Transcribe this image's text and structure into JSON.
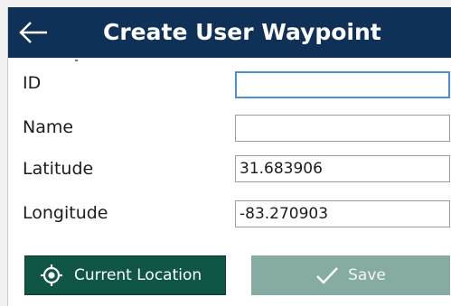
{
  "header": {
    "title": "Create User Waypoint"
  },
  "form": {
    "id": {
      "label": "ID",
      "value": ""
    },
    "name": {
      "label": "Name",
      "value": ""
    },
    "latitude": {
      "label": "Latitude",
      "value": "31.683906"
    },
    "longitude": {
      "label": "Longitude",
      "value": "-83.270903"
    }
  },
  "actions": {
    "current_location_label": "Current Location",
    "save_label": "Save"
  },
  "icons": {
    "back": "back-arrow-icon",
    "location": "crosshair-location-icon",
    "save": "checkmark-icon"
  },
  "colors": {
    "titlebar": "#0f3158",
    "location_button": "#0f5647",
    "save_button_disabled": "#86aba2",
    "focus_border": "#4c8fd6"
  }
}
